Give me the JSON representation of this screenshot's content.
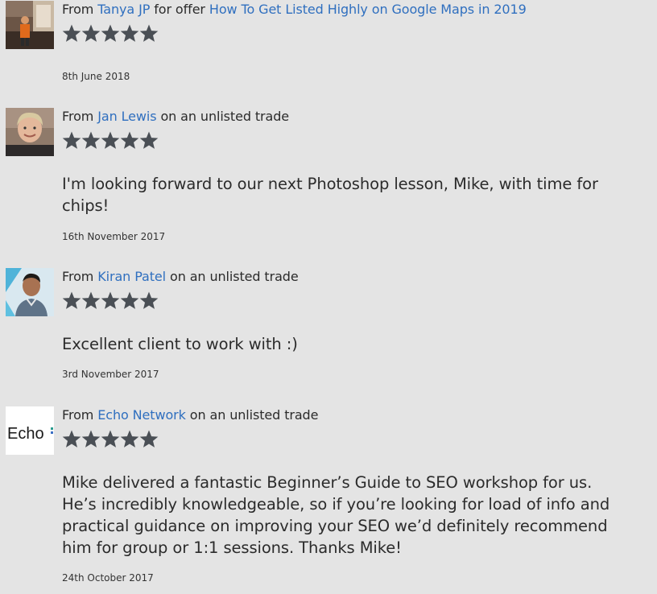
{
  "reviews": [
    {
      "from_prefix": "From",
      "author": "Tanya JP",
      "connector": "for offer",
      "offer": "How To Get Listed Highly on Google Maps in 2019",
      "rating": 5,
      "text": "",
      "date": "8th June 2018",
      "avatar": "photo-person-presenting"
    },
    {
      "from_prefix": "From",
      "author": "Jan Lewis",
      "connector": "on an unlisted trade",
      "offer": "",
      "rating": 5,
      "text": "I'm looking forward to our next Photoshop lesson, Mike, with time for chips!",
      "date": "16th November 2017",
      "avatar": "photo-person-smiling"
    },
    {
      "from_prefix": "From",
      "author": "Kiran Patel",
      "connector": "on an unlisted trade",
      "offer": "",
      "rating": 5,
      "text": "Excellent client to work with :)",
      "date": "3rd November 2017",
      "avatar": "photo-person-hoodie"
    },
    {
      "from_prefix": "From",
      "author": "Echo Network",
      "connector": "on an unlisted trade",
      "offer": "",
      "rating": 5,
      "text": "Mike delivered a fantastic Beginner’s Guide to SEO workshop for us. He’s incredibly knowledgeable, so if you’re looking for load of info and practical guidance on improving your SEO we’d definitely recommend him for group or 1:1 sessions. Thanks Mike!",
      "date": "24th October 2017",
      "avatar": "echo-logo",
      "logo_text": "Echo"
    }
  ],
  "colors": {
    "link": "#2f6fbf",
    "star": "#4a4f55",
    "background": "#e4e4e4"
  }
}
